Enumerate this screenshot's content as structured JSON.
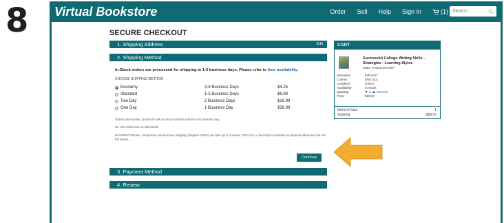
{
  "step_number": "8",
  "brand": "Virtual Bookstore",
  "nav": {
    "links": [
      "Order",
      "Sell",
      "Help",
      "Sign In"
    ],
    "cart_label": "(1)",
    "search_placeholder": "Search"
  },
  "colors": {
    "teal": "#106a74",
    "arrow": "#f2ad2f",
    "link": "#2a5db0"
  },
  "page_title": "SECURE CHECKOUT",
  "sections": {
    "shipping_address": "1. Shipping Address",
    "edit_label": "Edit",
    "shipping_method": "2. Shipping Method",
    "payment_method": "3. Payment Method",
    "review": "4. Review"
  },
  "shipping": {
    "intro": "In-Stock orders are processed for shipping in 1-2 business days. Please refer to",
    "intro_link": "Item availability.",
    "choose_label": "CHOOSE SHIPPING METHOD",
    "options": [
      {
        "name": "Economy",
        "days": "4-8 Business Days",
        "price": "$4.25",
        "selected": true
      },
      {
        "name": "Standard",
        "days": "1-5 Business Days",
        "price": "$6.98",
        "selected": false
      },
      {
        "name": "Two Day",
        "days": "2 Business Days",
        "price": "$16.99",
        "selected": false
      },
      {
        "name": "One Day",
        "days": "1 Business Day",
        "price": "$28.99",
        "selected": false
      }
    ],
    "note_1": "Orders placed after 11AM EST will not be processed until the next business day.",
    "note_2": "No UPS Deliveries on Weekends",
    "note_3": "HI/AK/PR/VI/Guam - Shipments via Economy Shipping (Regular USPS) can take up to 4 weeks. UPS One or Two Day is available for physical addresses but not PO Boxes.",
    "continue_label": "Continue"
  },
  "cart": {
    "header": "CART",
    "book_title": "Successful College Writing Skills - Strategies - Learning Styles",
    "isbn": "ISBN: 9780312676087",
    "meta_labels": [
      "Semester:",
      "Course:",
      "Condition:",
      "Availability:",
      "Quantity:",
      "Price:"
    ],
    "meta_values": [
      "Fall 2017",
      "ENG 111",
      "USED",
      "In Stock",
      "1",
      "$29.57"
    ],
    "remove_label": "Remove",
    "items_label": "Items in Cart:",
    "items_value": "1",
    "subtotal_label": "Subtotal:",
    "subtotal_value": "$29.57"
  }
}
